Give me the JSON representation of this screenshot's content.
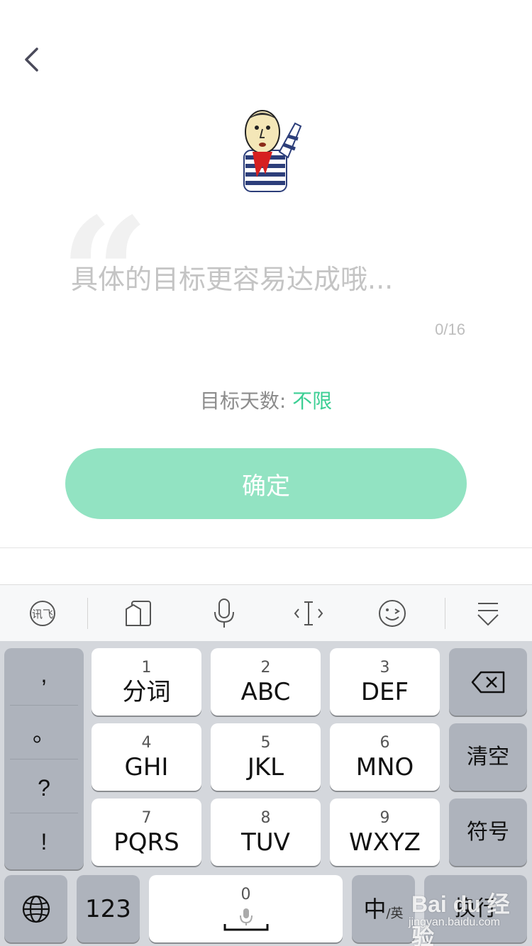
{
  "header": {
    "back_icon": "chevron-left-icon"
  },
  "goal": {
    "placeholder": "具体的目标更容易达成哦...",
    "value": "",
    "char_count": "0/16"
  },
  "target_days": {
    "label": "目标天数: ",
    "value": "不限"
  },
  "confirm_label": "确定",
  "colors": {
    "accent": "#3ccf94",
    "button": "#92e3c2",
    "keyboard_bg": "#d4d7dc"
  },
  "keyboard_toolbar": [
    {
      "icon": "ifly-logo-icon"
    },
    {
      "icon": "clipboard-icon"
    },
    {
      "icon": "microphone-icon"
    },
    {
      "icon": "cursor-icon"
    },
    {
      "icon": "emoji-icon"
    },
    {
      "icon": "hide-keyboard-icon"
    }
  ],
  "keyboard": {
    "punctuation": [
      ",",
      "。",
      "?",
      "!"
    ],
    "keys": [
      {
        "num": "1",
        "letters": "分词"
      },
      {
        "num": "2",
        "letters": "ABC"
      },
      {
        "num": "3",
        "letters": "DEF"
      },
      {
        "num": "4",
        "letters": "GHI"
      },
      {
        "num": "5",
        "letters": "JKL"
      },
      {
        "num": "6",
        "letters": "MNO"
      },
      {
        "num": "7",
        "letters": "PQRS"
      },
      {
        "num": "8",
        "letters": "TUV"
      },
      {
        "num": "9",
        "letters": "WXYZ"
      }
    ],
    "clear_label": "清空",
    "symbols_label": "符号",
    "numbers_label": "123",
    "space_num": "0",
    "lang_main": "中",
    "lang_sub": "/英",
    "enter_label": "换行"
  },
  "watermark": {
    "logo": "Bai du 经验",
    "url": "jingyan.baidu.com"
  }
}
